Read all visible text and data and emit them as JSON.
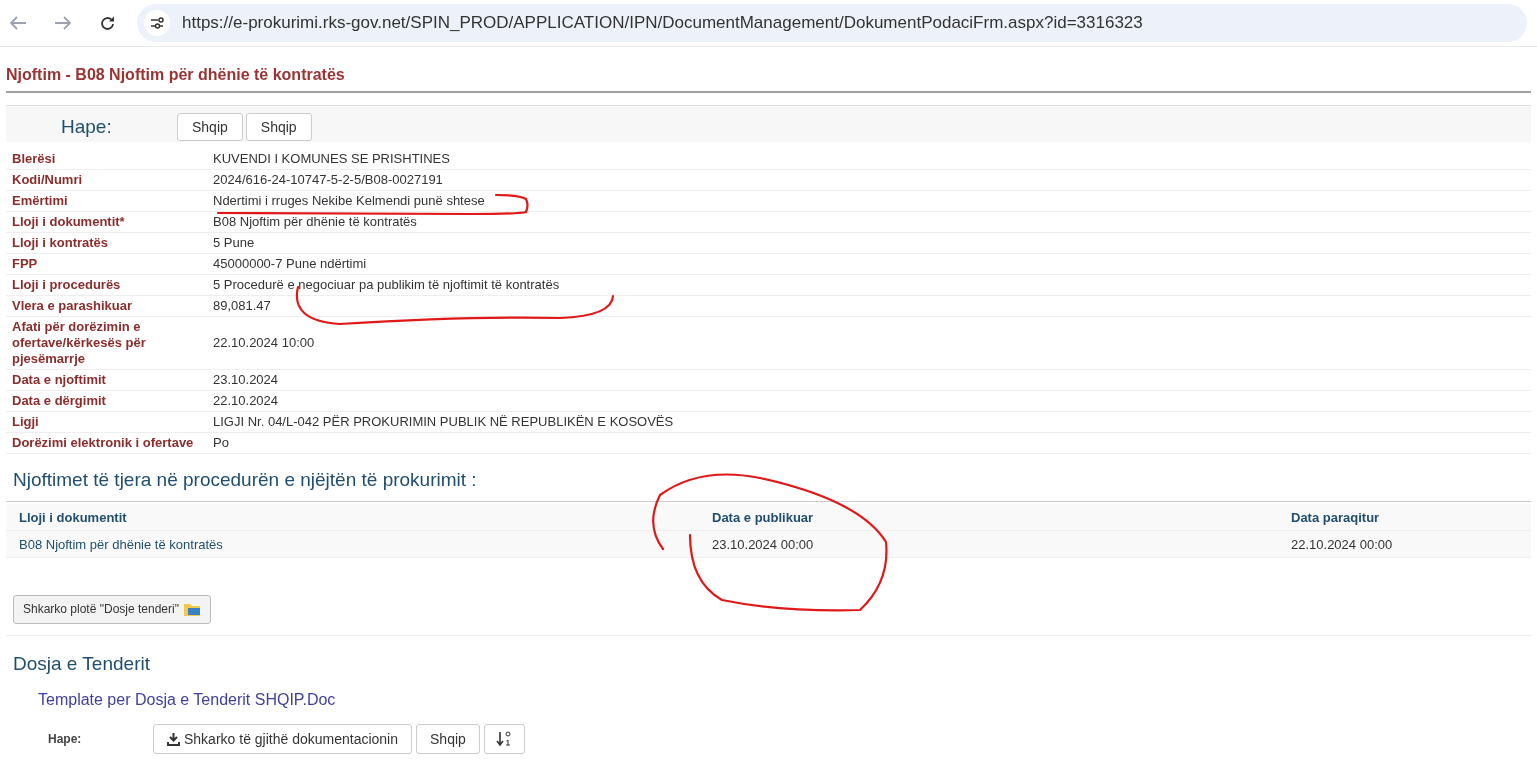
{
  "browser": {
    "url": "https://e-prokurimi.rks-gov.net/SPIN_PROD/APPLICATION/IPN/DocumentManagement/DokumentPodaciFrm.aspx?id=3316323"
  },
  "page_title": "Njoftim - B08 Njoftim për dhënie të kontratës",
  "open_bar": {
    "label": "Hape:",
    "buttons": [
      "Shqip",
      "Shqip"
    ]
  },
  "details": [
    {
      "label": "Blerësi",
      "value": "KUVENDI I KOMUNES SE PRISHTINES"
    },
    {
      "label": "Kodi/Numri",
      "value": "2024/616-24-10747-5-2-5/B08-0027191"
    },
    {
      "label": "Emërtimi",
      "value": "Ndertimi i rruges Nekibe Kelmendi punë shtese"
    },
    {
      "label": "Lloji i dokumentit*",
      "value": "B08 Njoftim për dhënie të kontratës"
    },
    {
      "label": "Lloji i kontratës",
      "value": "5 Pune"
    },
    {
      "label": "FPP",
      "value": "45000000-7 Pune ndërtimi"
    },
    {
      "label": "Lloji i procedurës",
      "value": "5 Procedurë e negociuar pa publikim të njoftimit të kontratës"
    },
    {
      "label": "Vlera e parashikuar",
      "value": "89,081.47"
    },
    {
      "label": "Afati për dorëzimin e ofertave/kërkesës për pjesëmarrje",
      "value": "22.10.2024 10:00"
    },
    {
      "label": "Data e njoftimit",
      "value": "23.10.2024"
    },
    {
      "label": "Data e dërgimit",
      "value": "22.10.2024"
    },
    {
      "label": "Ligji",
      "value": "LIGJI Nr. 04/L-042 PËR PROKURIMIN PUBLIK NË REPUBLIKËN E KOSOVËS"
    },
    {
      "label": "Dorëzimi elektronik i ofertave",
      "value": "Po"
    }
  ],
  "other_notices": {
    "heading": "Njoftimet të tjera në procedurën e njëjtën të prokurimit :",
    "columns": [
      "Lloji i dokumentit",
      "Data e publikuar",
      "Data paraqitur"
    ],
    "rows": [
      [
        "B08 Njoftim për dhënie të kontratës",
        "23.10.2024 00:00",
        "22.10.2024 00:00"
      ]
    ]
  },
  "download_zip_button": "Shkarko plotë \"Dosje tenderi\"",
  "tender_file": {
    "heading": "Dosja e Tenderit",
    "template_link": "Template per Dosja e Tenderit SHQIP.Doc",
    "open_label": "Hape:",
    "download_all_button": "Shkarko të gjithë dokumentacionin",
    "language_button": "Shqip"
  }
}
